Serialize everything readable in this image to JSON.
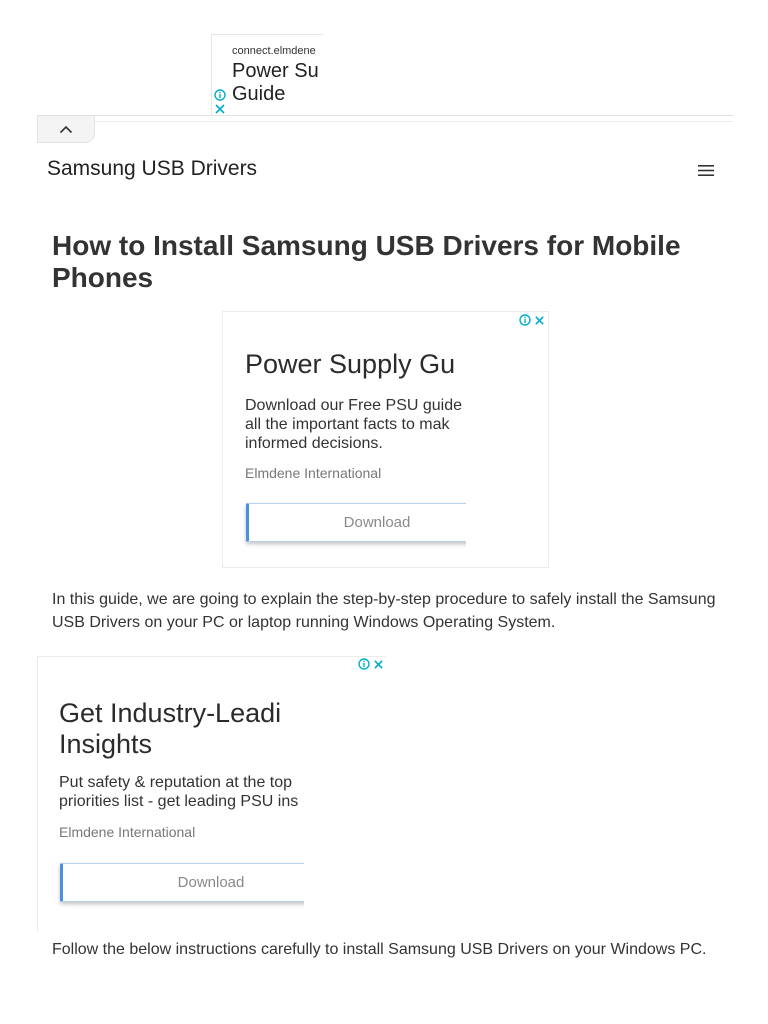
{
  "top_ad": {
    "domain": "connect.elmdene",
    "title_line1": "Power Su",
    "title_line2": "Guide"
  },
  "header": {
    "site_title": "Samsung USB Drivers"
  },
  "article": {
    "title": "How to Install Samsung USB Drivers for Mobile Phones",
    "para1": "In this guide, we are going to explain the step-by-step procedure to safely install the Samsung USB Drivers on your PC or laptop running Windows Operating System.",
    "para2": "Follow the below instructions carefully to install Samsung USB Drivers on your Windows PC."
  },
  "ad1": {
    "headline": "Power Supply Gu",
    "body_line1": "Download our Free PSU guide",
    "body_line2": "all the important facts to mak",
    "body_line3": "informed decisions.",
    "advertiser": "Elmdene International",
    "cta": "Download"
  },
  "ad2": {
    "headline_line1": "Get Industry-Leadi",
    "headline_line2": "Insights",
    "body_line1": "Put safety & reputation at the top",
    "body_line2": "priorities list - get leading PSU ins",
    "advertiser": "Elmdene International",
    "cta": "Download"
  },
  "icons": {
    "adchoices": "info-icon",
    "close": "close-icon",
    "collapse": "chevron-up-icon",
    "menu": "hamburger-menu-icon"
  },
  "colors": {
    "adchoices_blue": "#00aecd",
    "cta_border": "#4a90e2"
  }
}
